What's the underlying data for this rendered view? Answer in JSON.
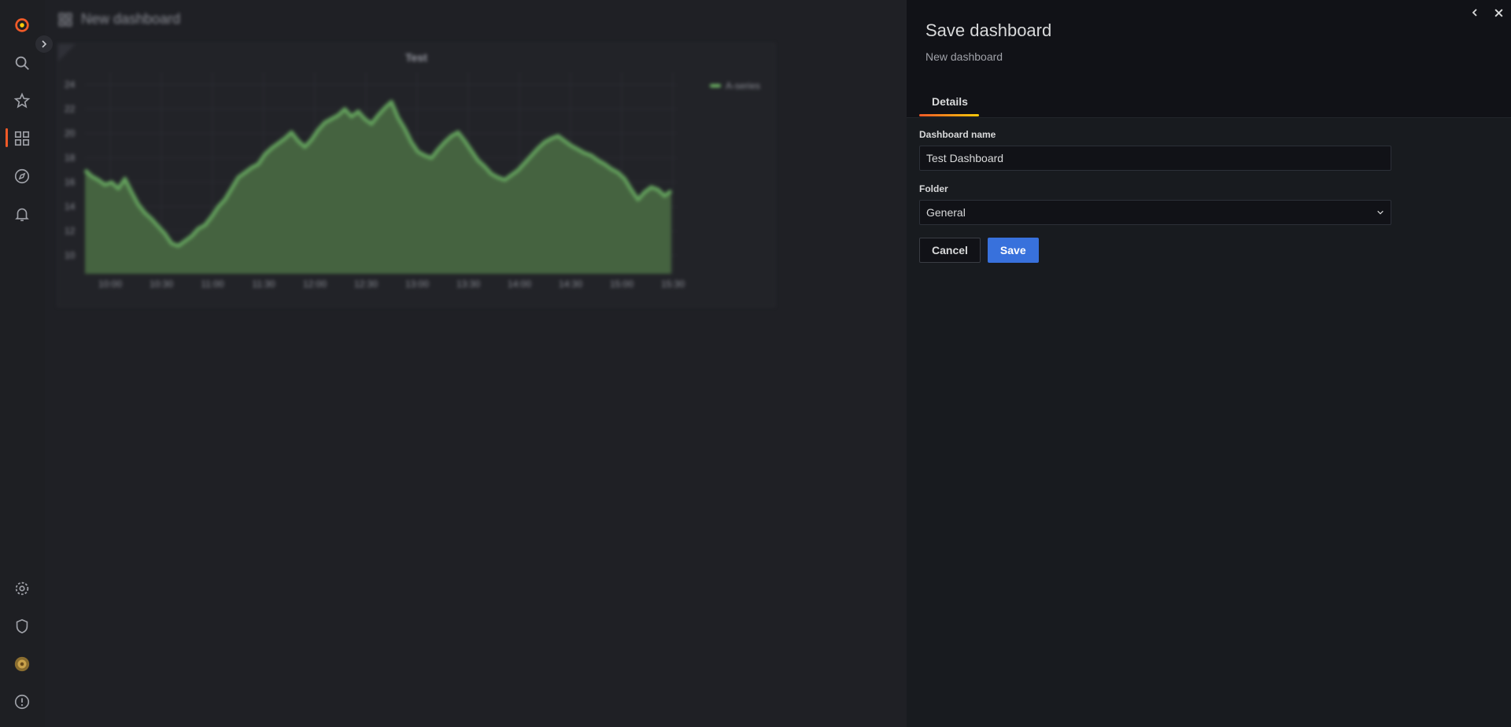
{
  "sidenav": {
    "items": [
      "grafana-logo-icon",
      "search-icon",
      "star-icon",
      "dashboards-icon",
      "explore-icon",
      "alerting-icon",
      "gear-icon",
      "shield-icon",
      "user-avatar",
      "help-icon"
    ]
  },
  "dashboard": {
    "title": "New dashboard",
    "panel": {
      "title": "Test",
      "legend": "A-series",
      "line_color": "#73bf69",
      "fill_color": "#4b6e44"
    }
  },
  "chart_data": {
    "type": "area",
    "title": "Test",
    "series": [
      {
        "name": "A-series",
        "values": [
          17,
          16.5,
          16.2,
          15.8,
          16,
          15.5,
          16.3,
          15.2,
          14.2,
          13.5,
          13,
          12.4,
          11.8,
          11,
          10.8,
          11.2,
          11.6,
          12.2,
          12.5,
          13.2,
          14,
          14.6,
          15.5,
          16.4,
          16.8,
          17.2,
          17.5,
          18.3,
          18.8,
          19.2,
          19.6,
          20.1,
          19.4,
          18.9,
          19.5,
          20.3,
          20.9,
          21.2,
          21.5,
          22,
          21.4,
          21.8,
          21.2,
          20.8,
          21.5,
          22.1,
          22.6,
          21.3,
          20.4,
          19.3,
          18.5,
          18.2,
          18,
          18.7,
          19.3,
          19.8,
          20.1,
          19.4,
          18.6,
          17.8,
          17.3,
          16.7,
          16.4,
          16.2,
          16.6,
          17,
          17.6,
          18.2,
          18.8,
          19.3,
          19.6,
          19.8,
          19.4,
          19,
          18.7,
          18.4,
          18.2,
          17.8,
          17.5,
          17.1,
          16.8,
          16.3,
          15.4,
          14.6,
          15.2,
          15.6,
          15.4,
          14.9,
          15.3
        ]
      }
    ],
    "x_ticks": [
      "10:00",
      "10:30",
      "11:00",
      "11:30",
      "12:00",
      "12:30",
      "13:00",
      "13:30",
      "14:00",
      "14:30",
      "15:00",
      "15:30"
    ],
    "y_ticks": [
      "10",
      "12",
      "14",
      "16",
      "18",
      "20",
      "22",
      "24"
    ],
    "ylim": [
      8.5,
      25
    ],
    "legend_position": "top-right",
    "grid": true
  },
  "drawer": {
    "title": "Save dashboard",
    "subtitle": "New dashboard",
    "tab": "Details",
    "dashboard_name_label": "Dashboard name",
    "dashboard_name_value": "Test Dashboard",
    "folder_label": "Folder",
    "folder_value": "General",
    "cancel_label": "Cancel",
    "save_label": "Save",
    "accent": "#f05a28",
    "primary": "#3871dc"
  }
}
